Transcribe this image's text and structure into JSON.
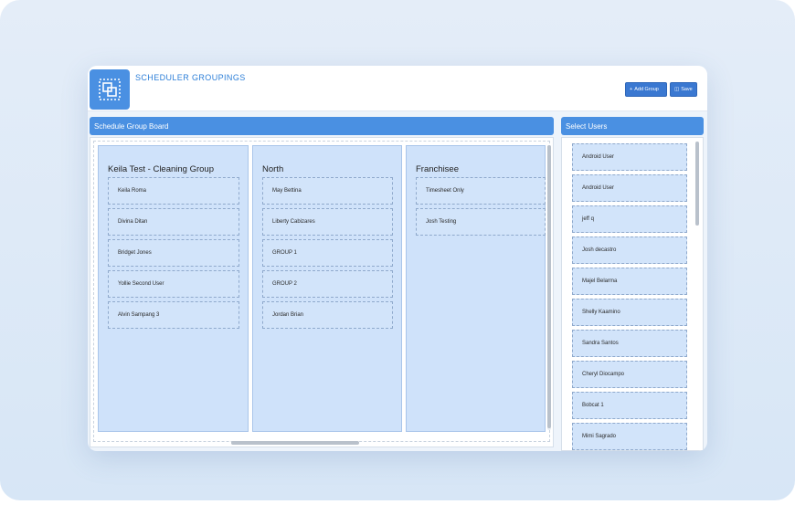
{
  "header": {
    "title": "SCHEDULER GROUPINGS",
    "logo_icon": "group-select-icon",
    "add_group_label": "Add Group",
    "save_label": "Save"
  },
  "board": {
    "title": "Schedule Group Board",
    "groups": [
      {
        "name": "Keila Test - Cleaning Group",
        "members": [
          "Keila Roma",
          "Divina Ditan",
          "Bridget Jones",
          "Yollie Second User",
          "Alvin Sampang 3"
        ]
      },
      {
        "name": "North",
        "members": [
          "May Bettina",
          "Liberty Cabizares",
          "GROUP 1",
          "GROUP 2",
          "Jordan Brian"
        ]
      },
      {
        "name": "Franchisee",
        "members": [
          "Timesheet Only",
          "Josh Testing"
        ]
      }
    ]
  },
  "users_panel": {
    "title": "Select Users",
    "users": [
      "Android User",
      "Android User",
      "jeff q",
      "Josh decastro",
      "Majel Belarma",
      "Shelly Kaamino",
      "Sandra Santos",
      "Cheryl Diocampo",
      "Bobcat 1",
      "Mimi Sagrado"
    ]
  },
  "colors": {
    "accent": "#4a90e2",
    "button": "#3a78d1",
    "card": "#cfe2fa"
  }
}
